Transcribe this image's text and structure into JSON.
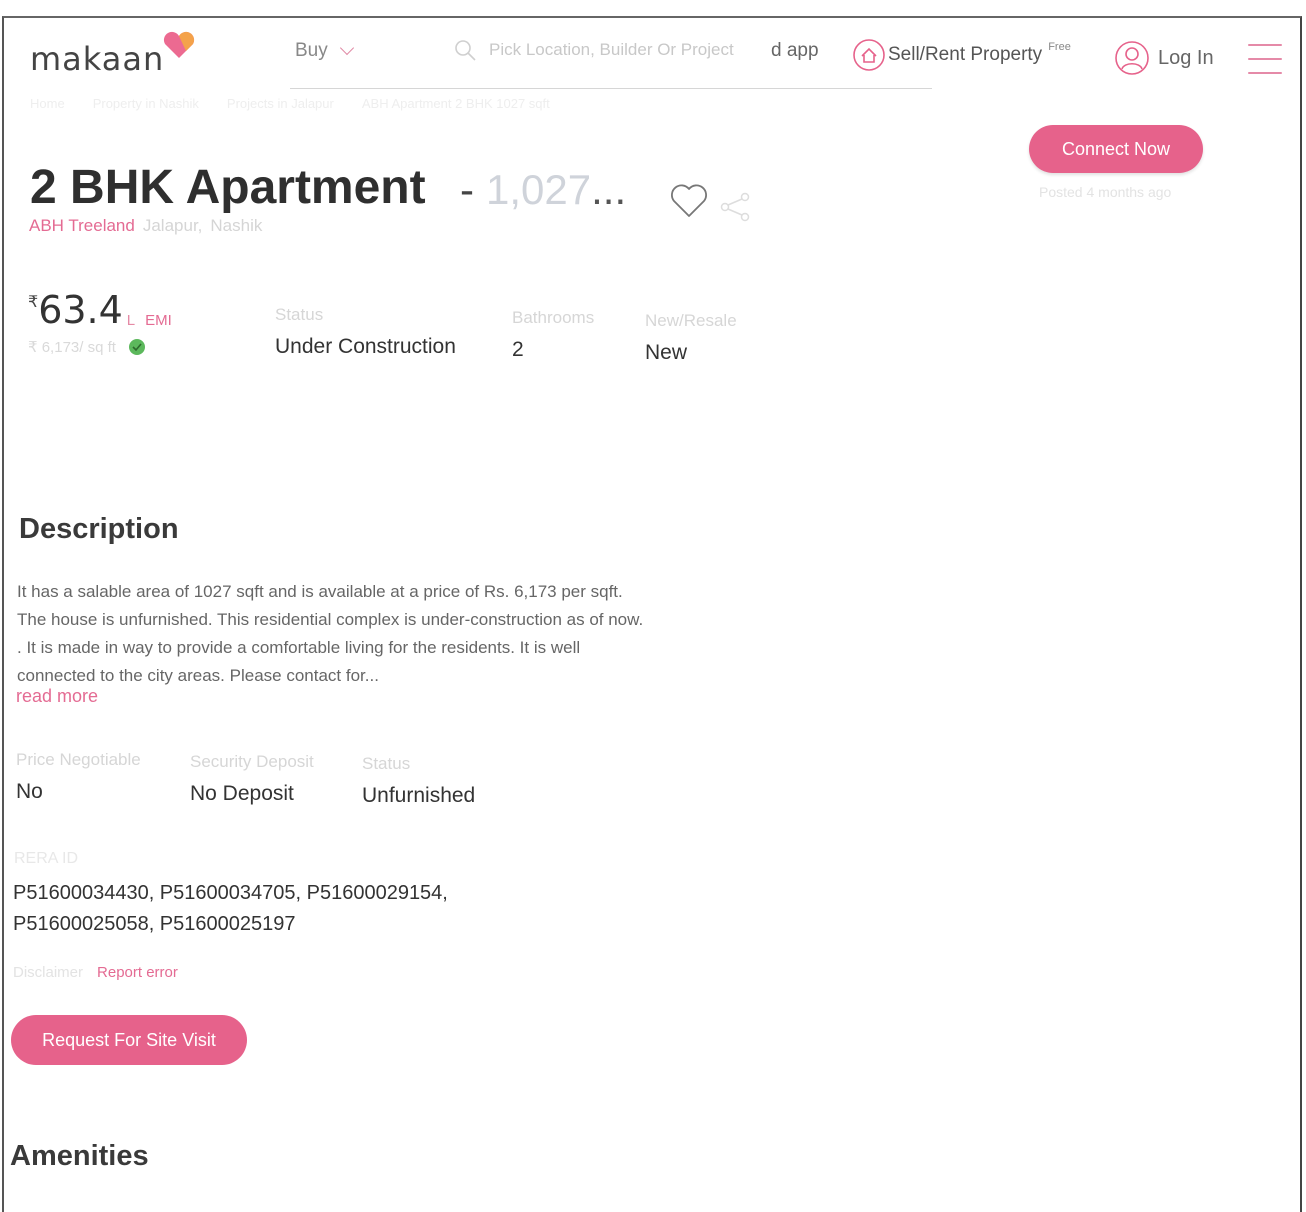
{
  "header": {
    "logo_text": "makaan",
    "buy_label": "Buy",
    "search_placeholder": "Pick Location, Builder Or Project",
    "search_overlap_text": "d app",
    "sell_label": "Sell/Rent Property",
    "sell_badge": "Free",
    "login_label": "Log In"
  },
  "breadcrumb": [
    "Home",
    "Property in Nashik",
    "Projects in Jalapur",
    "ABH Apartment 2 BHK 1027 sqft"
  ],
  "listing": {
    "title": "2 BHK Apartment",
    "title_separator": "-",
    "area_truncated": "1,027",
    "ellipsis": "...",
    "project": "ABH Treeland",
    "locality": "Jalapur,",
    "city": "Nashik",
    "connect_label": "Connect Now",
    "posted": "Posted 4 months ago"
  },
  "price": {
    "symbol": "₹",
    "amount": "63.4",
    "unit": "L",
    "emi_label": "EMI",
    "per_sqft": "₹ 6,173/ sq ft"
  },
  "attributes": [
    {
      "label": "Status",
      "value": "Under Construction"
    },
    {
      "label": "Bathrooms",
      "value": "2"
    },
    {
      "label": "New/Resale",
      "value": "New"
    }
  ],
  "description": {
    "heading": "Description",
    "text": "It has a salable area of 1027 sqft and is available at a price of Rs. 6,173 per sqft. The house is unfurnished. This residential complex is under-construction as of now. . It is made in way to provide a comfortable living for the residents. It is well connected to the city areas. Please contact for...",
    "read_more": "read more"
  },
  "details": [
    {
      "label": "Price Negotiable",
      "value": "No"
    },
    {
      "label": "Security Deposit",
      "value": "No Deposit"
    },
    {
      "label": "Status",
      "value": "Unfurnished"
    }
  ],
  "rera": {
    "label": "RERA ID",
    "value": "P51600034430, P51600034705, P51600029154, P51600025058, P51600025197"
  },
  "links": {
    "disclaimer": "Disclaimer",
    "report": "Report error"
  },
  "site_visit_label": "Request For Site Visit",
  "amenities_heading": "Amenities",
  "colors": {
    "accent": "#e6628b",
    "link": "#e46b93",
    "text_dark": "#333333",
    "label_light": "#d6d6d6",
    "check_green": "#5cb85c"
  }
}
